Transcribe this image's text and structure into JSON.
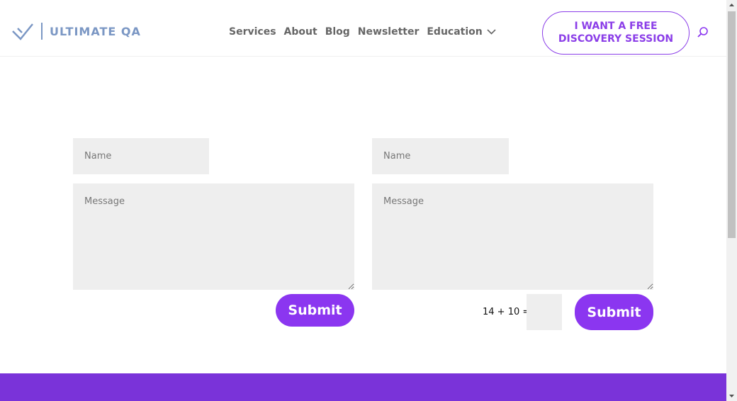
{
  "header": {
    "logo_text": "ULTIMATE QA",
    "nav": [
      {
        "label": "Services"
      },
      {
        "label": "About"
      },
      {
        "label": "Blog"
      },
      {
        "label": "Newsletter"
      },
      {
        "label": "Education"
      }
    ],
    "cta_line1": "I WANT A FREE",
    "cta_line2": "DISCOVERY SESSION"
  },
  "forms": {
    "left": {
      "name_placeholder": "Name",
      "message_placeholder": "Message",
      "submit_label": "Submit"
    },
    "right": {
      "name_placeholder": "Name",
      "message_placeholder": "Message",
      "captcha_text": "14 + 10 =",
      "submit_label": "Submit"
    }
  },
  "colors": {
    "accent": "#8b36f0",
    "logo": "#7b97c4",
    "footer_band": "#7a33d9"
  }
}
